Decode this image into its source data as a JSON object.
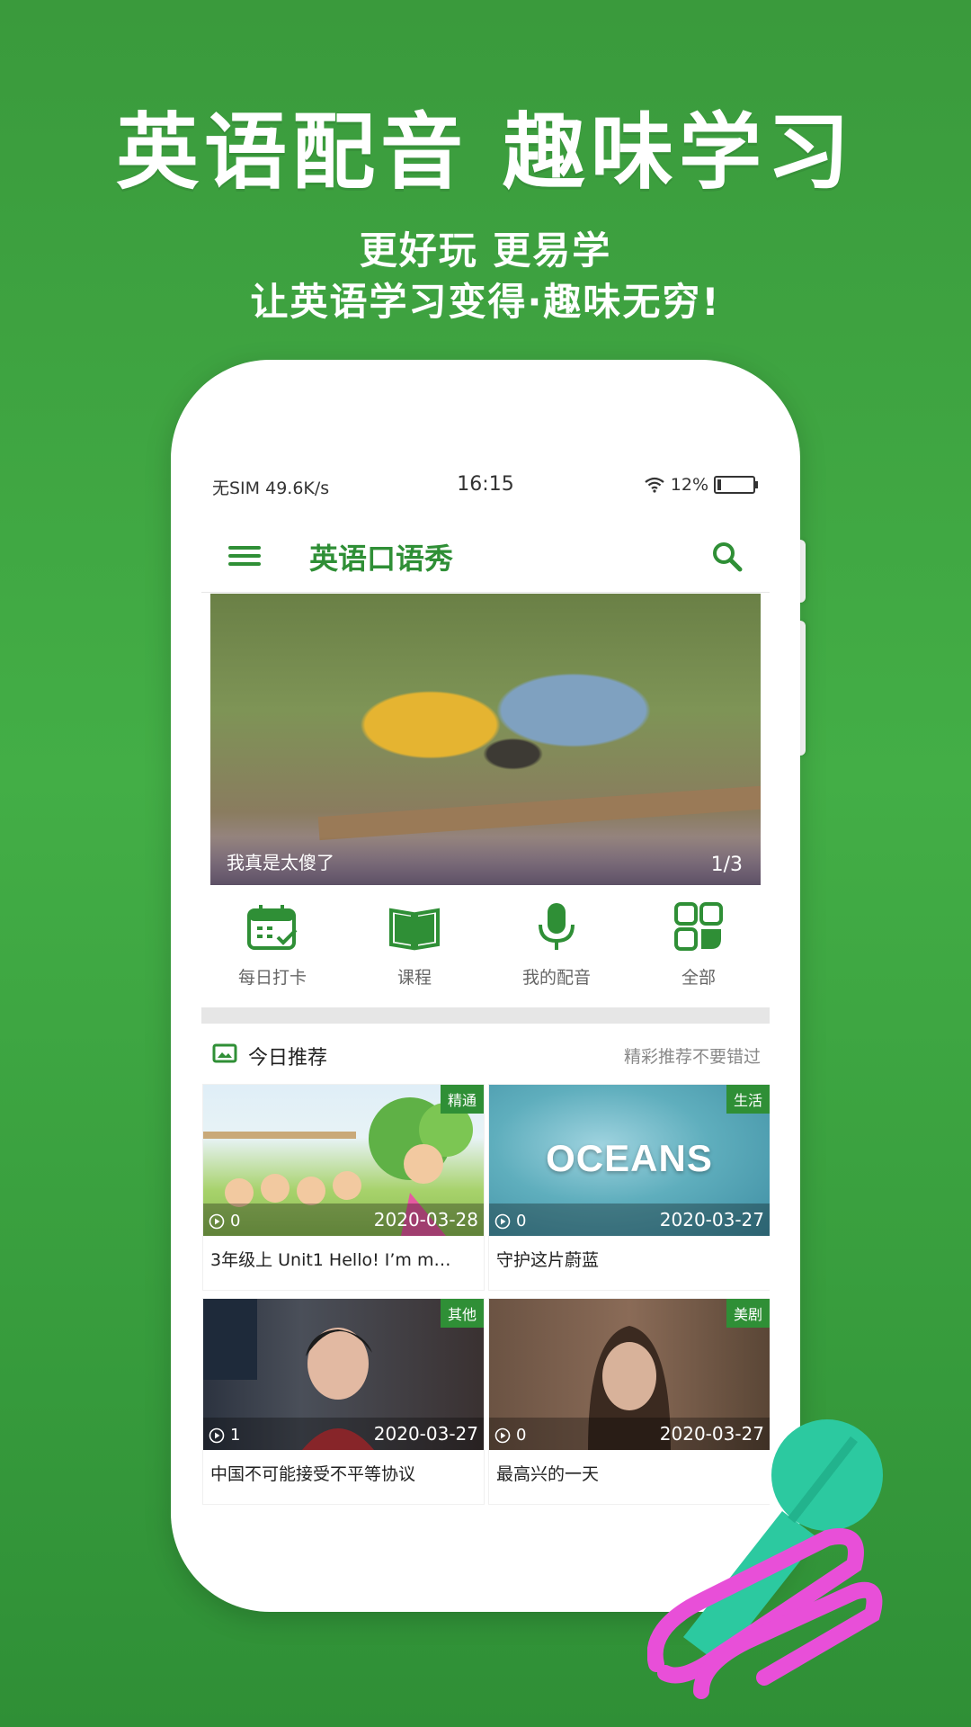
{
  "promo": {
    "headline": "英语配音 趣味学习",
    "subline1": "更好玩 更易学",
    "subline2": "让英语学习变得·趣味无穷!"
  },
  "status_bar": {
    "carrier": "无SIM",
    "speed": "49.6K/s",
    "time": "16:15",
    "battery": "12%"
  },
  "app_bar": {
    "title": "英语口语秀",
    "menu_icon": "menu-icon",
    "search_icon": "search-icon"
  },
  "banner": {
    "caption": "我真是太傻了",
    "indicator": "1/3"
  },
  "quick_actions": [
    {
      "label": "每日打卡",
      "icon": "calendar-check-icon"
    },
    {
      "label": "课程",
      "icon": "book-open-icon"
    },
    {
      "label": "我的配音",
      "icon": "microphone-icon"
    },
    {
      "label": "全部",
      "icon": "grid-icon"
    }
  ],
  "recommendations": {
    "title": "今日推荐",
    "more": "精彩推荐不要错过",
    "items": [
      {
        "tag": "精通",
        "plays": "0",
        "date": "2020-03-28",
        "title": "3年级上 Unit1 Hello! I’m m…"
      },
      {
        "tag": "生活",
        "plays": "0",
        "date": "2020-03-27",
        "title": "守护这片蔚蓝",
        "thumb_text": "OCEANS"
      },
      {
        "tag": "其他",
        "plays": "1",
        "date": "2020-03-27",
        "title": "中国不可能接受不平等协议"
      },
      {
        "tag": "美剧",
        "plays": "0",
        "date": "2020-03-27",
        "title": "最高兴的一天"
      }
    ]
  },
  "colors": {
    "brand_green": "#2f8f36",
    "background_green": "#43ae46",
    "mic_teal": "#2cc9a0",
    "mic_pink": "#e84fd8"
  }
}
